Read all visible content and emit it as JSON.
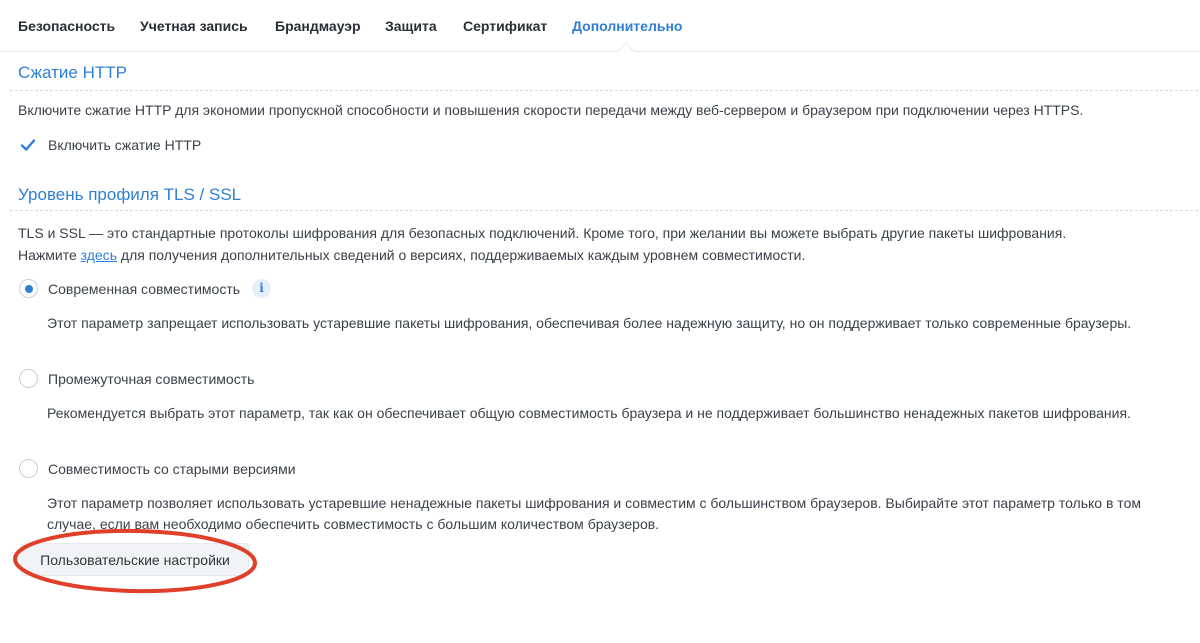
{
  "tabs": [
    {
      "label": "Безопасность",
      "active": false
    },
    {
      "label": "Учетная запись",
      "active": false
    },
    {
      "label": "Брандмауэр",
      "active": false
    },
    {
      "label": "Защита",
      "active": false
    },
    {
      "label": "Сертификат",
      "active": false
    },
    {
      "label": "Дополнительно",
      "active": true
    }
  ],
  "http_compression": {
    "title": "Сжатие HTTP",
    "description": "Включите сжатие HTTP для экономии пропускной способности и повышения скорости передачи между веб-сервером и браузером при подключении через HTTPS.",
    "checkbox_label": "Включить сжатие HTTP",
    "checkbox_checked": true
  },
  "tls": {
    "title": "Уровень профиля TLS / SSL",
    "description_line1": "TLS и SSL — это стандартные протоколы шифрования для безопасных подключений. Кроме того, при желании вы можете выбрать другие пакеты шифрования.",
    "description_prefix": "Нажмите ",
    "link_text": "здесь",
    "description_suffix": " для получения дополнительных сведений о версиях, поддерживаемых каждым уровнем совместимости.",
    "options": [
      {
        "label": "Современная совместимость",
        "checked": true,
        "description": "Этот параметр запрещает использовать устаревшие пакеты шифрования, обеспечивая более надежную защиту, но он поддерживает только современные браузеры."
      },
      {
        "label": "Промежуточная совместимость",
        "checked": false,
        "description": "Рекомендуется выбрать этот параметр, так как он обеспечивает общую совместимость браузера и не поддерживает большинство ненадежных пакетов шифрования."
      },
      {
        "label": "Совместимость со старыми версиями",
        "checked": false,
        "description": "Этот параметр позволяет использовать устаревшие ненадежные пакеты шифрования и совместим с большинством браузеров. Выбирайте этот параметр только в том случае, если вам необходимо обеспечить совместимость с большим количеством браузеров."
      }
    ],
    "custom_button_label": "Пользовательские настройки"
  },
  "colors": {
    "accent": "#2f7fd6",
    "annotation": "#e0402b"
  }
}
